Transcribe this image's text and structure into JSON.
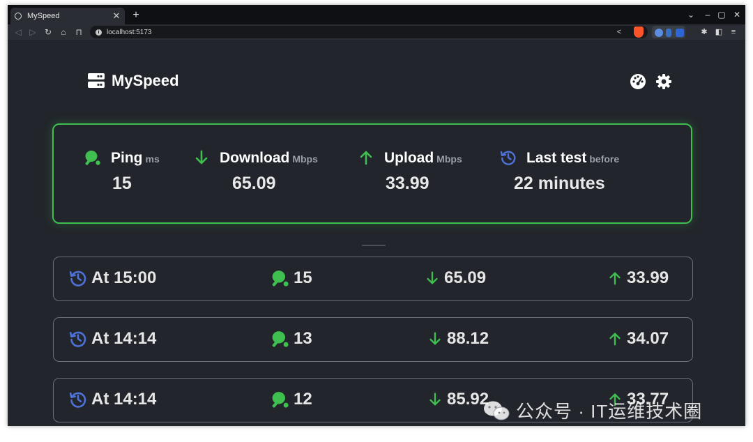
{
  "browser": {
    "tab_title": "MySpeed",
    "tab_close": "✕",
    "new_tab": "+",
    "url": "localhost:5173",
    "window_controls": [
      "⌄",
      "–",
      "▢",
      "✕"
    ]
  },
  "app": {
    "title": "MySpeed",
    "icons": {
      "logo": "server-icon",
      "speedometer": "speedometer-icon",
      "settings": "gear-icon"
    }
  },
  "stats": [
    {
      "label": "Ping",
      "unit": "ms",
      "value": "15",
      "icon": "ping-pong-icon"
    },
    {
      "label": "Download",
      "unit": "Mbps",
      "value": "65.09",
      "icon": "arrow-down-icon"
    },
    {
      "label": "Upload",
      "unit": "Mbps",
      "value": "33.99",
      "icon": "arrow-up-icon"
    },
    {
      "label": "Last test",
      "unit": "before",
      "value": "22 minutes",
      "icon": "history-icon"
    }
  ],
  "history": [
    {
      "time": "At 15:00",
      "ping": "15",
      "download": "65.09",
      "upload": "33.99"
    },
    {
      "time": "At 14:14",
      "ping": "13",
      "download": "88.12",
      "upload": "34.07"
    },
    {
      "time": "At 14:14",
      "ping": "12",
      "download": "85.92",
      "upload": "33.77"
    }
  ],
  "watermark": "公众号 · IT运维技术圈",
  "colors": {
    "accent_green": "#3fbf4f",
    "history_blue": "#4f72d8",
    "background": "#22252b"
  }
}
